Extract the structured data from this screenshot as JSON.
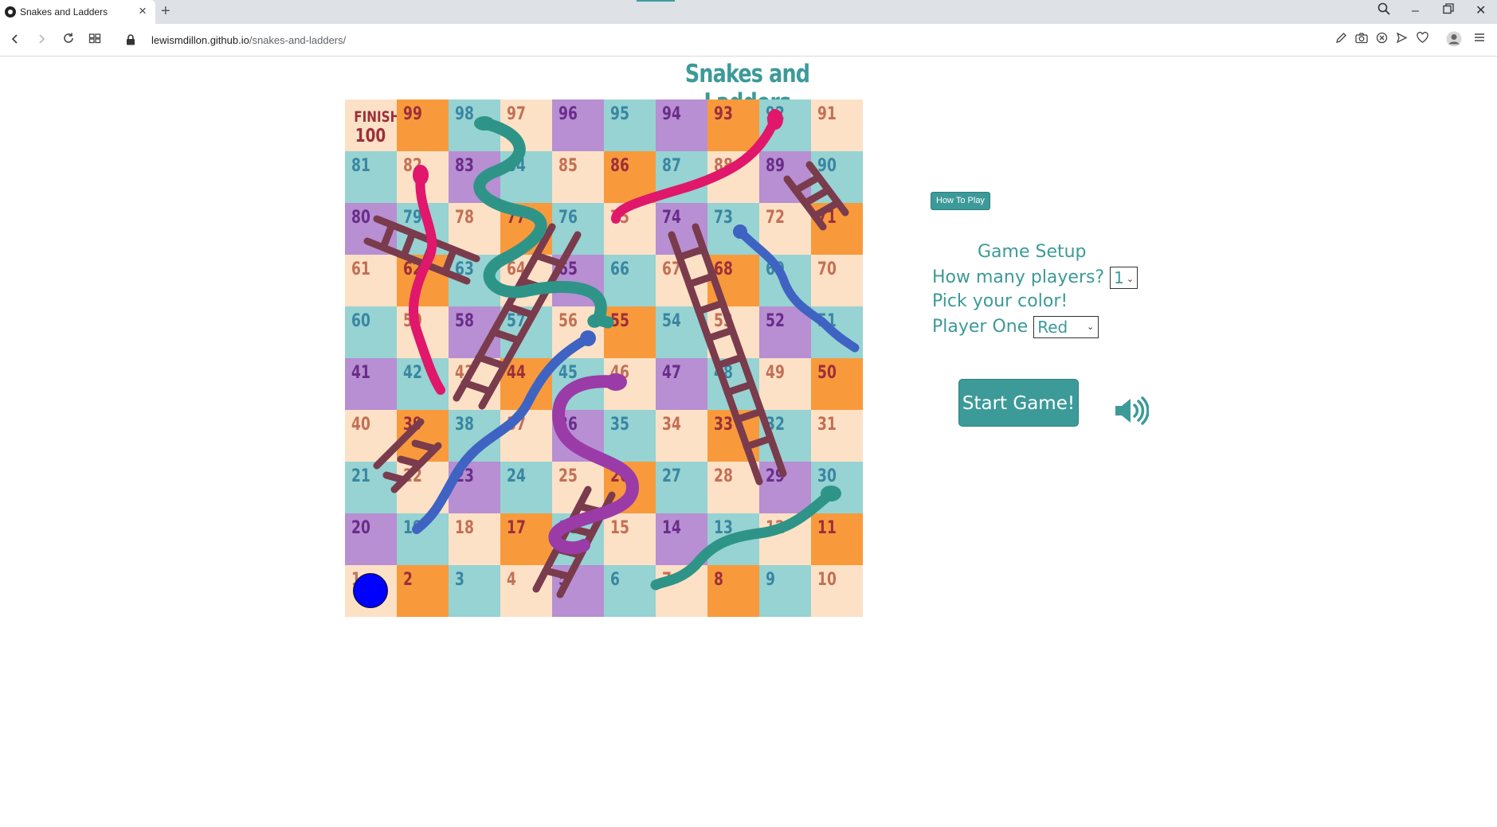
{
  "browser": {
    "tab_title": "Snakes and Ladders",
    "url_domain": "lewismdillon.github.io",
    "url_path": "/snakes-and-ladders/"
  },
  "page": {
    "title": "Snakes and Ladders",
    "how_to_play": "How To Play",
    "setup_title": "Game Setup",
    "players_label": "How many players?",
    "players_value": "1",
    "pick_color_label": "Pick your color!",
    "player_one_label": "Player One",
    "player_one_color": "Red",
    "start_button": "Start Game!"
  },
  "board": {
    "finish_label": "FINISH",
    "colors": {
      "peach": "#fde1c6",
      "orange": "#f89a3c",
      "teal": "#96d3d2",
      "purple": "#b78fd2"
    },
    "rows": [
      [
        "100",
        "99",
        "98",
        "97",
        "96",
        "95",
        "94",
        "93",
        "92",
        "91"
      ],
      [
        "81",
        "82",
        "83",
        "84",
        "85",
        "86",
        "87",
        "88",
        "89",
        "90"
      ],
      [
        "80",
        "79",
        "78",
        "77",
        "76",
        "75",
        "74",
        "73",
        "72",
        "71"
      ],
      [
        "61",
        "62",
        "63",
        "64",
        "65",
        "66",
        "67",
        "68",
        "69",
        "70"
      ],
      [
        "60",
        "59",
        "58",
        "57",
        "56",
        "55",
        "54",
        "53",
        "52",
        "51"
      ],
      [
        "41",
        "42",
        "43",
        "44",
        "45",
        "46",
        "47",
        "48",
        "49",
        "50"
      ],
      [
        "40",
        "39",
        "38",
        "37",
        "36",
        "35",
        "34",
        "33",
        "32",
        "31"
      ],
      [
        "21",
        "22",
        "23",
        "24",
        "25",
        "26",
        "27",
        "28",
        "29",
        "30"
      ],
      [
        "20",
        "19",
        "18",
        "17",
        "16",
        "15",
        "14",
        "13",
        "12",
        "11"
      ],
      [
        "1",
        "2",
        "3",
        "4",
        "5",
        "6",
        "7",
        "8",
        "9",
        "10"
      ]
    ],
    "player_token_color": "#0000ff"
  }
}
